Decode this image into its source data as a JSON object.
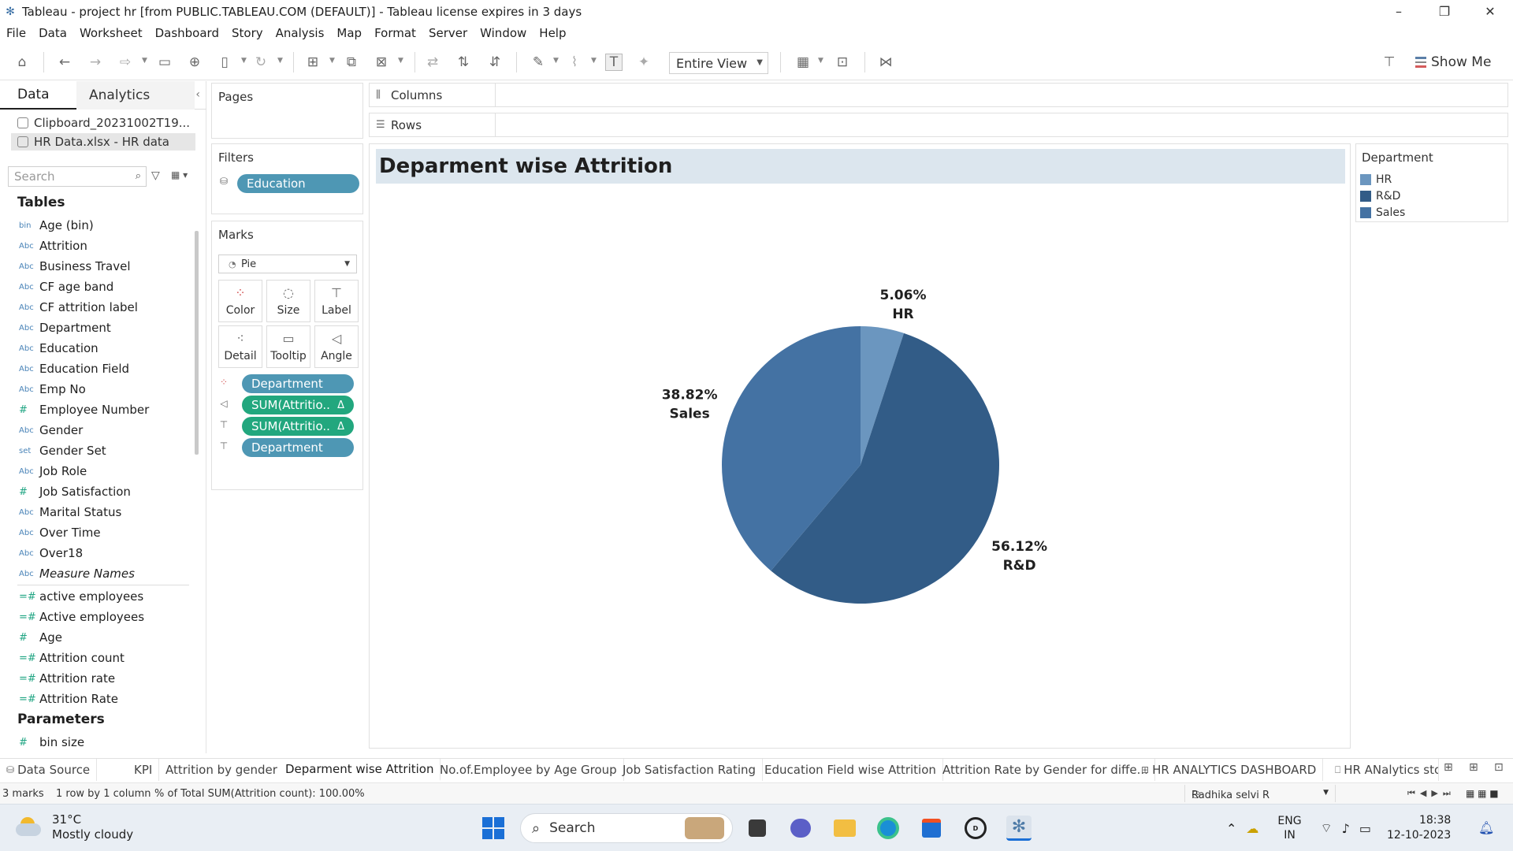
{
  "window": {
    "title": "Tableau - project hr [from PUBLIC.TABLEAU.COM (DEFAULT)] - Tableau license expires in 3 days",
    "minimize": "–",
    "restore": "❐",
    "close": "✕"
  },
  "menu": [
    "File",
    "Data",
    "Worksheet",
    "Dashboard",
    "Story",
    "Analysis",
    "Map",
    "Format",
    "Server",
    "Window",
    "Help"
  ],
  "toolbar": {
    "fit_mode": "Entire View",
    "show_me": "Show Me"
  },
  "data_pane": {
    "tabs": [
      "Data",
      "Analytics"
    ],
    "data_sources": [
      "Clipboard_20231002T19...",
      "HR Data.xlsx - HR data"
    ],
    "search_placeholder": "Search",
    "tables_heading": "Tables",
    "parameters_heading": "Parameters",
    "dimensions": [
      {
        "type": "bin",
        "name": "Age (bin)"
      },
      {
        "type": "Abc",
        "name": "Attrition"
      },
      {
        "type": "Abc",
        "name": "Business Travel"
      },
      {
        "type": "Abc",
        "name": "CF age band"
      },
      {
        "type": "Abc",
        "name": "CF attrition label"
      },
      {
        "type": "Abc",
        "name": "Department"
      },
      {
        "type": "Abc",
        "name": "Education"
      },
      {
        "type": "Abc",
        "name": "Education Field"
      },
      {
        "type": "Abc",
        "name": "Emp No"
      },
      {
        "type": "#",
        "name": "Employee Number"
      },
      {
        "type": "Abc",
        "name": "Gender"
      },
      {
        "type": "set",
        "name": "Gender Set"
      },
      {
        "type": "Abc",
        "name": "Job Role"
      },
      {
        "type": "#",
        "name": "Job Satisfaction"
      },
      {
        "type": "Abc",
        "name": "Marital Status"
      },
      {
        "type": "Abc",
        "name": "Over Time"
      },
      {
        "type": "Abc",
        "name": "Over18"
      },
      {
        "type": "Abc",
        "name": "Measure Names"
      }
    ],
    "measures": [
      {
        "type": "=#",
        "name": "active employees"
      },
      {
        "type": "=#",
        "name": "Active employees"
      },
      {
        "type": "#",
        "name": "Age"
      },
      {
        "type": "=#",
        "name": "Attrition count"
      },
      {
        "type": "=#",
        "name": "Attrition rate"
      },
      {
        "type": "=#",
        "name": "Attrition Rate"
      }
    ],
    "parameters": [
      {
        "type": "#",
        "name": "bin size"
      }
    ]
  },
  "cards": {
    "pages": "Pages",
    "filters": "Filters",
    "filter_pills": [
      "Education"
    ],
    "marks": "Marks",
    "mark_type": "Pie",
    "mark_buttons": [
      "Color",
      "Size",
      "Label",
      "Detail",
      "Tooltip",
      "Angle"
    ],
    "mark_pills": [
      {
        "kind": "dim",
        "text": "Department"
      },
      {
        "kind": "mea",
        "text": "SUM(Attritio.."
      },
      {
        "kind": "mea",
        "text": "SUM(Attritio.."
      },
      {
        "kind": "dim",
        "text": "Department"
      }
    ]
  },
  "shelves": {
    "columns": "Columns",
    "rows": "Rows"
  },
  "sheet_title": "Deparment wise Attrition",
  "legend": {
    "title": "Department",
    "items": [
      {
        "label": "HR",
        "color": "#6b96bf"
      },
      {
        "label": "R&D",
        "color": "#325c87"
      },
      {
        "label": "Sales",
        "color": "#4472a3"
      }
    ]
  },
  "chart_data": {
    "type": "pie",
    "categories": [
      "HR",
      "R&D",
      "Sales"
    ],
    "values": [
      5.06,
      56.12,
      38.82
    ],
    "value_labels": [
      "5.06%",
      "56.12%",
      "38.82%"
    ],
    "colors": [
      "#6b96bf",
      "#325c87",
      "#4472a3"
    ],
    "title": "Deparment wise Attrition"
  },
  "sheet_tabs": [
    {
      "label": "Data Source",
      "glyph": "⛁"
    },
    {
      "label": "KPI",
      "glyph": ""
    },
    {
      "label": "Attrition by gender",
      "glyph": ""
    },
    {
      "label": "Deparment wise Attrition",
      "glyph": "",
      "active": true
    },
    {
      "label": "No.of.Employee by Age Group",
      "glyph": ""
    },
    {
      "label": "Job Satisfaction Rating",
      "glyph": ""
    },
    {
      "label": "Education Field wise Attrition",
      "glyph": ""
    },
    {
      "label": "Attrition Rate by Gender for diffe...",
      "glyph": ""
    },
    {
      "label": "HR ANALYTICS DASHBOARD",
      "glyph": "⊞"
    },
    {
      "label": "HR ANalytics sto",
      "glyph": "⎕"
    }
  ],
  "status": {
    "marks": "3 marks",
    "dims": "1 row by 1 column",
    "summary": "% of Total SUM(Attrition count): 100.00%",
    "user": "Radhika selvi R"
  },
  "taskbar": {
    "temp": "31°C",
    "weather": "Mostly cloudy",
    "search": "Search",
    "lang1": "ENG",
    "lang2": "IN",
    "time": "18:38",
    "date": "12-10-2023"
  }
}
